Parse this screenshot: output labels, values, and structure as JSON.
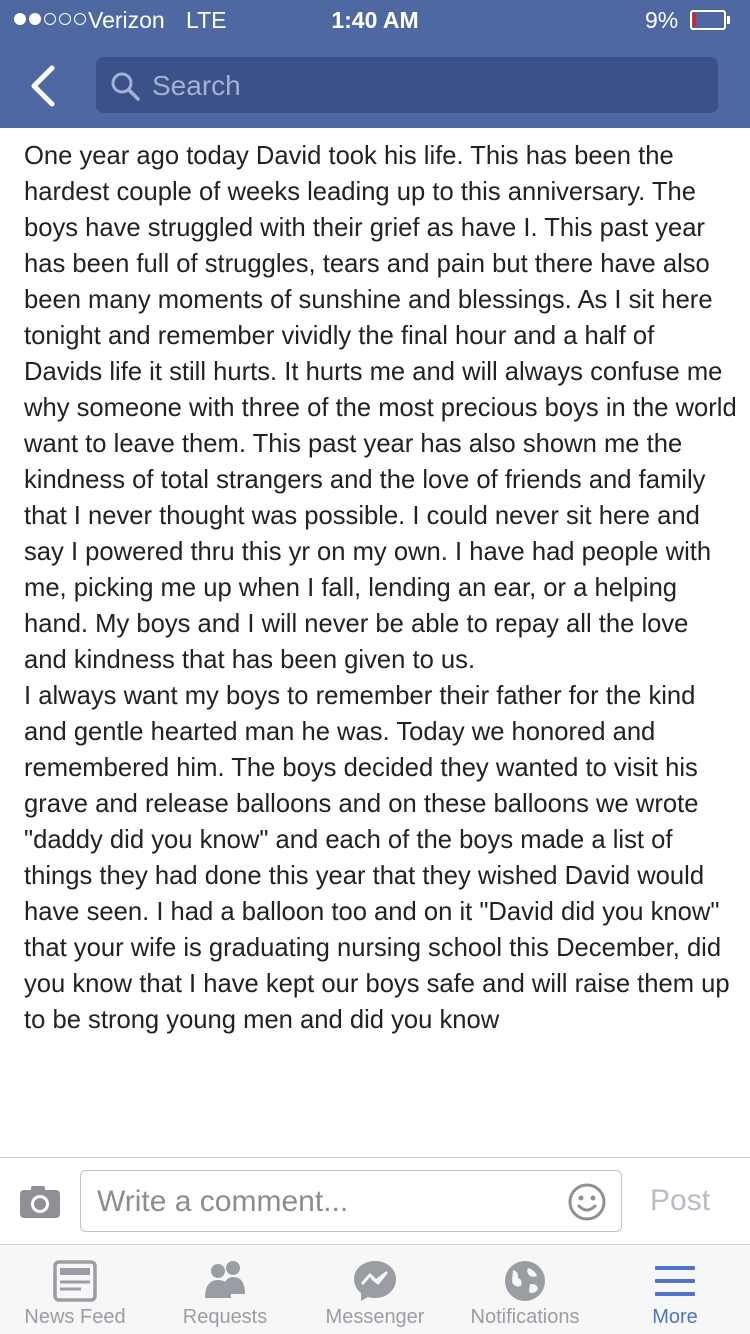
{
  "status_bar": {
    "carrier": "Verizon",
    "network": "LTE",
    "time": "1:40 AM",
    "battery": "9%",
    "signal_bars": 2,
    "battery_level_fraction": 0.09
  },
  "nav": {
    "search_placeholder": "Search",
    "colors": {
      "bar": "#4e69a2",
      "search_field": "#3a518a"
    }
  },
  "post": {
    "paragraphs": [
      "One year ago today David took his life. This has been the hardest couple of weeks leading up to this anniversary. The boys have struggled with their grief as have I. This past year has been full of struggles, tears and pain but there have also been many moments of sunshine and blessings. As I sit here tonight and remember vividly the final hour and a half of Davids life it still hurts. It hurts me and will always confuse me why someone with three of the most precious boys in the world want to leave them. This past year has also shown me the kindness of total strangers and the love of friends and family that I never thought was possible. I could never sit here and say I powered thru this yr on my own. I have had people with me, picking me up when I fall, lending an ear, or a helping hand. My boys and I will never be able to repay all the love and kindness that has been given to us.",
      "I always want my boys to remember their father for the kind and gentle hearted man he was. Today we honored and remembered him. The boys decided they wanted to visit his grave and release balloons and on these balloons we wrote \"daddy did you know\" and each of the boys made a list of things they had done this year that they wished David would have seen. I had a balloon too and on it \"David did you know\" that your wife is graduating nursing school this December, did you know that I have kept our boys safe and will raise them up to be strong young men and did you know"
    ]
  },
  "comment": {
    "placeholder": "Write a comment...",
    "post_label": "Post"
  },
  "tabs": [
    {
      "label": "News Feed",
      "icon": "news-feed-icon",
      "active": false
    },
    {
      "label": "Requests",
      "icon": "friend-requests-icon",
      "active": false
    },
    {
      "label": "Messenger",
      "icon": "messenger-icon",
      "active": false
    },
    {
      "label": "Notifications",
      "icon": "globe-icon",
      "active": false
    },
    {
      "label": "More",
      "icon": "menu-icon",
      "active": true
    }
  ],
  "colors": {
    "tab_inactive": "#9a9da3",
    "tab_active": "#4e75c9"
  }
}
